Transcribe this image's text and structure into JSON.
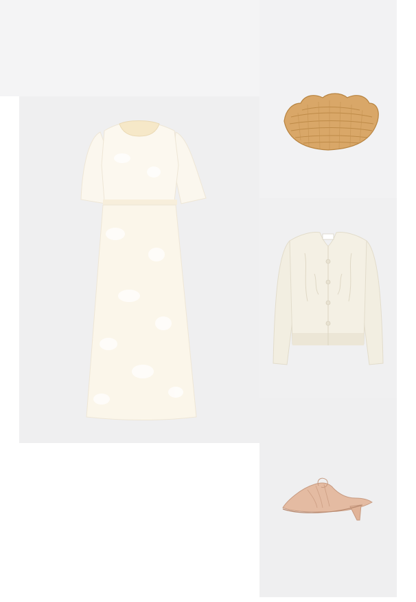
{
  "outfit": {
    "items": [
      {
        "name": "dress",
        "color": "#fbf6ea"
      },
      {
        "name": "woven-clutch",
        "color": "#d8a667"
      },
      {
        "name": "cardigan",
        "color": "#f3efe2"
      },
      {
        "name": "mule-shoe",
        "color": "#e3b9a0"
      }
    ],
    "panel_colors": {
      "background": "#ffffff",
      "panel": "#f0f0f1"
    }
  }
}
